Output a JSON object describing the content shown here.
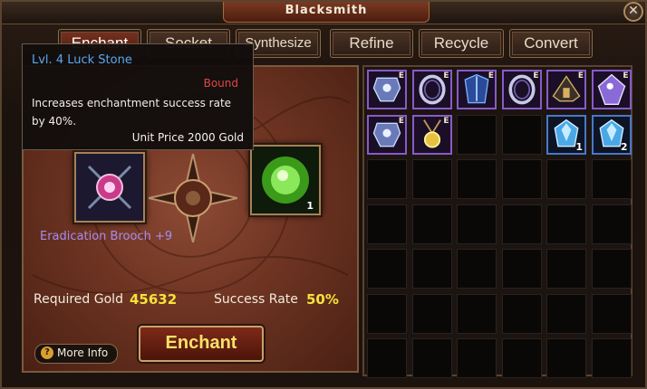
{
  "window": {
    "title": "Blacksmith",
    "close": "✕"
  },
  "tabs": [
    {
      "label": "Enchant",
      "active": true
    },
    {
      "label": "Socket"
    },
    {
      "label": "Synthesize"
    },
    {
      "label": "Refine"
    },
    {
      "label": "Recycle"
    },
    {
      "label": "Convert"
    }
  ],
  "tooltip": {
    "title": "Lvl. 4 Luck Stone",
    "status": "Bound",
    "description": "Increases enchantment success rate by 40%.",
    "price": "Unit Price 2000 Gold"
  },
  "enchant": {
    "item_name": "Eradication Brooch +9",
    "stone_count": "1",
    "required_gold_label": "Required Gold",
    "required_gold_value": "45632",
    "success_rate_label": "Success Rate",
    "success_rate_value": "50%",
    "enchant_button": "Enchant",
    "more_info": "More Info",
    "more_info_icon": "?"
  },
  "inventory": {
    "columns": 6,
    "rows": 7,
    "items": [
      {
        "slot": 0,
        "icon": "armor-icon",
        "tag": "E",
        "color": "#8a5ac8"
      },
      {
        "slot": 1,
        "icon": "ring-icon",
        "tag": "E",
        "color": "#8a5ac8"
      },
      {
        "slot": 2,
        "icon": "chest-armor-icon",
        "tag": "E",
        "color": "#8a5ac8"
      },
      {
        "slot": 3,
        "icon": "ring-icon",
        "tag": "E",
        "color": "#8a5ac8"
      },
      {
        "slot": 4,
        "icon": "helmet-icon",
        "tag": "E",
        "color": "#8a5ac8"
      },
      {
        "slot": 5,
        "icon": "gem-icon",
        "tag": "E",
        "color": "#8a5ac8"
      },
      {
        "slot": 6,
        "icon": "armor-icon",
        "tag": "E",
        "color": "#8a5ac8"
      },
      {
        "slot": 7,
        "icon": "amulet-icon",
        "tag": "E",
        "color": "#8a5ac8"
      },
      {
        "slot": 10,
        "icon": "crystal-icon",
        "count": "1",
        "color": "#4a78c8"
      },
      {
        "slot": 11,
        "icon": "crystal-icon",
        "count": "2",
        "color": "#4a78c8"
      }
    ]
  }
}
